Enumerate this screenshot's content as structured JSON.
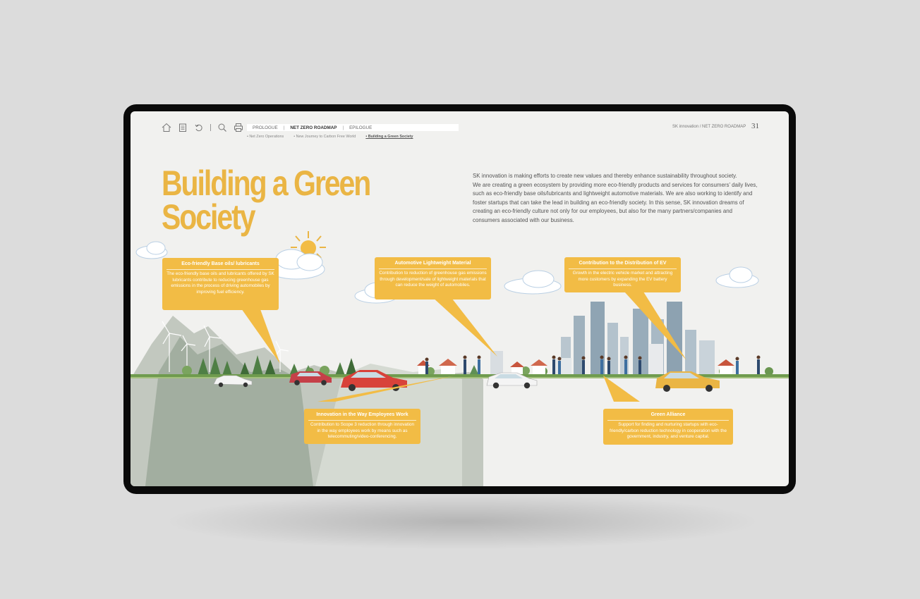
{
  "toolbar": {
    "icons": [
      "home-icon",
      "list-icon",
      "undo-icon",
      "search-icon",
      "print-icon"
    ]
  },
  "nav": {
    "tabs": [
      "PROLOGUE",
      "NET ZERO ROADMAP",
      "EPILOGUE"
    ],
    "active_tab": "NET ZERO ROADMAP",
    "subtabs": [
      "• Net Zero Operations",
      "• New Journey to Carbon Free World",
      "• Building a Green Society"
    ],
    "active_subtab": "• Building a Green Society"
  },
  "header": {
    "brand_path": "SK innovation / NET ZERO ROADMAP",
    "page_number": "31"
  },
  "page": {
    "title_line1": "Building a Green",
    "title_line2": "Society",
    "intro_line1": "SK innovation is making efforts to create new values and thereby enhance sustainability throughout society.",
    "intro_body": "We are creating a green ecosystem by providing more eco-friendly products and services for consumers’ daily lives, such as eco-friendly base oils/lubricants and lightweight automotive materials. We are also working to identify and foster startups that can take the lead in building an eco-friendly society. In this sense, SK innovation dreams of creating an eco-friendly culture not only for our employees, but also for the many partners/companies and consumers associated with our business."
  },
  "callouts": {
    "base_oils": {
      "title": "Eco-friendly Base oils/ lubricants",
      "body": "The eco-friendly base oils and lubricants offered by SK lubricants contribute to reducing greenhouse gas emissions in the process of driving automobiles by improving fuel efficiency."
    },
    "lightweight": {
      "title": "Automotive Lightweight Material",
      "body": "Contribution to reduction of greenhouse gas emissions through development/sale of lightweight materials that can reduce the weight of automobiles."
    },
    "ev": {
      "title": "Contribution to the Distribution of EV",
      "body": "Growth in the electric vehicle market and attracting more customers by expanding the EV battery business."
    },
    "work": {
      "title": "Innovation in the Way Employees Work",
      "body": "Contribution to Scope 3 reduction through innovation in the way employees work by means such as telecommuting/video-conferencing."
    },
    "alliance": {
      "title": "Green Alliance",
      "body": "Support for finding and nurturing startups with eco-friendly/carbon reduction technology in cooperation with the government, industry, and venture capital."
    }
  },
  "colors": {
    "accent": "#eab544",
    "callout": "#f2bc45",
    "background": "#f1f1ef",
    "device": "#0a0a0a"
  }
}
